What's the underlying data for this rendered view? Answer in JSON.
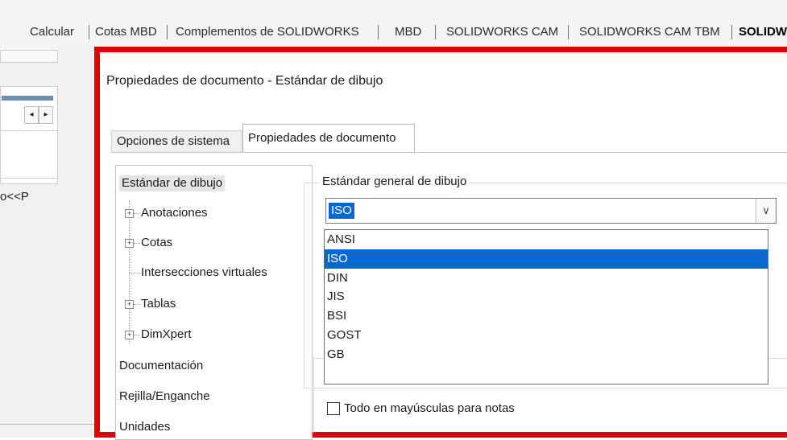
{
  "top_tabs": [
    "Calcular",
    "Cotas MBD",
    "Complementos de SOLIDWORKS",
    "MBD",
    "SOLIDWORKS CAM",
    "SOLIDWORKS CAM TBM",
    "SOLIDW"
  ],
  "left_panel": {
    "partial_text": "o<<P"
  },
  "dialog": {
    "title": "Propiedades de documento - Estándar de dibujo",
    "tabs": [
      "Opciones de sistema",
      "Propiedades de documento"
    ],
    "active_tab": "Propiedades de documento",
    "tree": [
      "Estándar de dibujo",
      "Anotaciones",
      "Cotas",
      "Intersecciones virtuales",
      "Tablas",
      "DimXpert",
      "Documentación",
      "Rejilla/Enganche",
      "Unidades"
    ],
    "group_label": "Estándar general de dibujo",
    "combo_value": "ISO",
    "dropdown_options": [
      "ANSI",
      "ISO",
      "DIN",
      "JIS",
      "BSI",
      "GOST",
      "GB"
    ],
    "dropdown_selected": "ISO",
    "checkbox_label": "Todo en mayúsculas para notas",
    "checkbox_checked": false
  },
  "colors": {
    "highlight_frame": "#e00000",
    "selection": "#0a66d0"
  },
  "icons": {
    "expand": "plus-box-icon",
    "combo_arrow": "chevron-down-icon",
    "scroll_left": "arrow-left-icon",
    "scroll_right": "arrow-right-icon"
  }
}
